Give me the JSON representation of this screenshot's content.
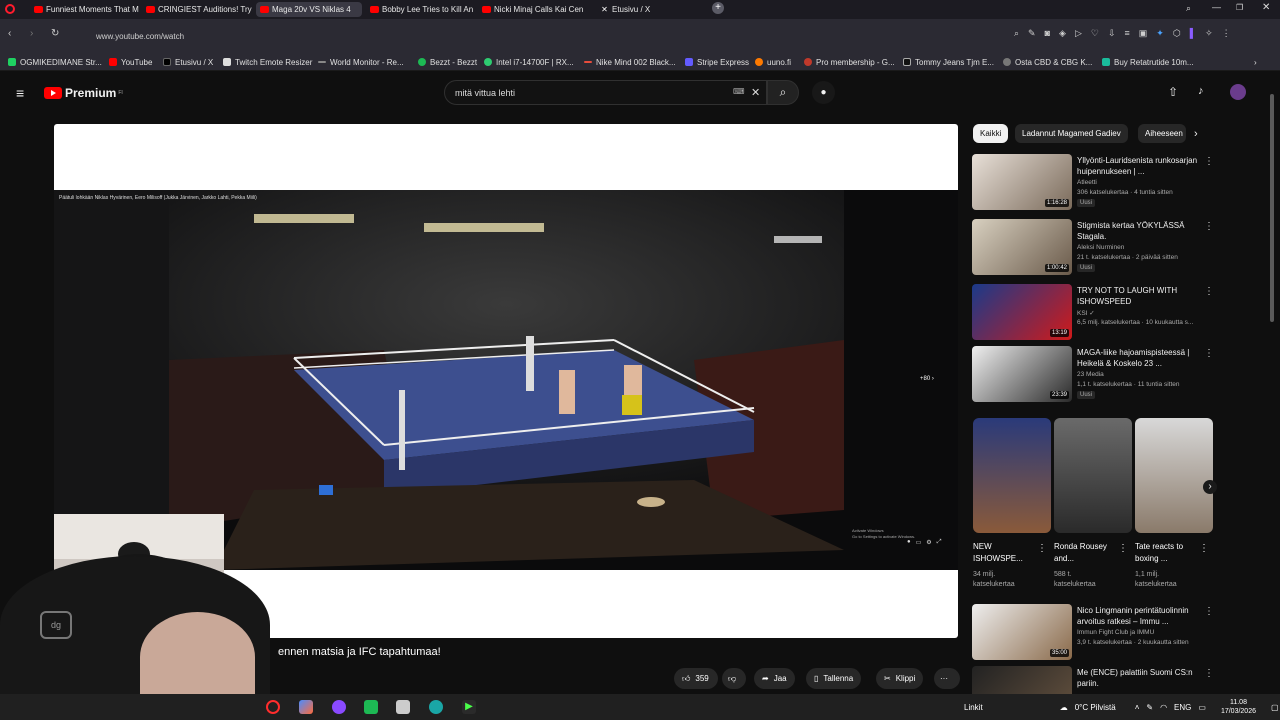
{
  "browser": {
    "tabs": [
      {
        "label": "Funniest Moments That M",
        "icon": "youtube-icon"
      },
      {
        "label": "CRINGIEST Auditions! Try",
        "icon": "youtube-icon"
      },
      {
        "label": "Maga 20v VS Niklas 4",
        "icon": "youtube-icon",
        "active": true
      },
      {
        "label": "Bobby Lee Tries to Kill An",
        "icon": "youtube-icon"
      },
      {
        "label": "Nicki Minaj Calls Kai Cen",
        "icon": "youtube-icon"
      },
      {
        "label": "Etusivu / X",
        "icon": "x-icon"
      }
    ],
    "url": "www.youtube.com/watch",
    "bookmarks": [
      "OGMIKEDIMANE Str...",
      "YouTube",
      "Etusivu / X",
      "Twitch Emote Resizer",
      "World Monitor - Re...",
      "Bezzt - Bezzt",
      "Intel i7-14700F | RX...",
      "Nike Mind 002 Black...",
      "Stripe Express",
      "uuno.fi",
      "Pro membership - G...",
      "Tommy Jeans Tjm E...",
      "Osta CBD & CBG K...",
      "Buy Retatrutide 10m..."
    ]
  },
  "youtube": {
    "logo_text": "Premium",
    "logo_sup": "FI",
    "search_value": "mitä vittua lehti",
    "video_overlay_title": "Päätuli lohkään Niklas Hyvärinen, Eero Milisoff (Jukka Järvinen, Jarkko Lahti, Pekka Miili)",
    "progress": 0.57,
    "watermark_line1": "Activate Windows",
    "watermark_line2": "Go to Settings to activate Windows.",
    "caption": "ennen matsia ja IFC tapahtumaa!",
    "end_card": "+80",
    "actions": {
      "likes": "359",
      "share": "Jaa",
      "save": "Tallenna",
      "clip": "Klippi",
      "more": "···"
    },
    "chips": [
      "Kaikki",
      "Ladannut Magamed Gadiev",
      "Aiheeseen"
    ],
    "recommendations": [
      {
        "title": "Yllyönti-Lauridsenista runkosarjan huipennukseen | ...",
        "channel": "Atleetti",
        "meta": "306 katselukertaa · 4 tuntia sitten",
        "badge": "Uusi",
        "duration": "1:16:28"
      },
      {
        "title": "Stigmista kertaa YÖKYLÄSSÄ Stagala.",
        "channel": "Aleksi Nurminen",
        "meta": "21 t. katselukertaa · 2 päivää sitten",
        "badge": "Uusi",
        "duration": "1:00:42"
      },
      {
        "title": "TRY NOT TO LAUGH WITH ISHOWSPEED",
        "channel": "KSI ✓",
        "meta": "6,5 milj. katselukertaa · 10 kuukautta s...",
        "badge": "",
        "duration": "13:19"
      },
      {
        "title": "MAGA-liike hajoamispisteessä | Heikelä & Koskelo 23 ...",
        "channel": "23 Media",
        "meta": "1,1 t. katselukertaa · 11 tuntia sitten",
        "badge": "Uusi",
        "duration": "23:39"
      }
    ],
    "shorts": [
      {
        "title": "NEW ISHOWSPE...",
        "views_line1": "34 milj.",
        "views_line2": "katselukertaa"
      },
      {
        "title": "Ronda Rousey and...",
        "views_line1": "588 t.",
        "views_line2": "katselukertaa"
      },
      {
        "title": "Tate reacts to boxing ...",
        "views_line1": "1,1 milj.",
        "views_line2": "katselukertaa"
      }
    ],
    "recommendations_more": [
      {
        "title": "Nico Lingmanin perintätuolinnin arvoitus ratkesi – Immu ...",
        "channel": "Immun Fight Club ja IMMU",
        "meta": "3,9 t. katselukertaa · 2 kuukautta sitten",
        "duration": "35:00"
      },
      {
        "title": "Me (ENCE) palattiin Suomi CS:n pariin.",
        "channel": "",
        "meta": "",
        "duration": ""
      }
    ]
  },
  "taskbar": {
    "links": "Linkit",
    "weather": "0°C Pilvistä",
    "lang": "ENG",
    "time": "11.08",
    "date": "17/03/2026"
  }
}
